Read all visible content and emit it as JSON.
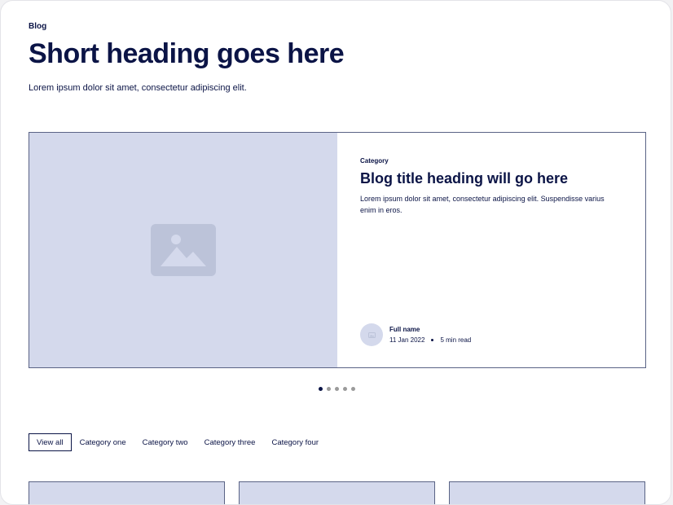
{
  "section": {
    "tagline": "Blog",
    "heading": "Short heading goes here",
    "description": "Lorem ipsum dolor sit amet, consectetur adipiscing elit."
  },
  "featured_post": {
    "image_icon": "image-placeholder-icon",
    "category": "Category",
    "title": "Blog title heading will go here",
    "description": "Lorem ipsum dolor sit amet, consectetur adipiscing elit. Suspendisse varius enim in eros.",
    "author": {
      "avatar_icon": "avatar-placeholder-icon",
      "name": "Full name",
      "date": "11 Jan 2022",
      "read_time": "5 min read"
    }
  },
  "carousel": {
    "slide_count": 5,
    "active_index": 0
  },
  "filter_tabs": [
    {
      "label": "View all",
      "active": true
    },
    {
      "label": "Category one",
      "active": false
    },
    {
      "label": "Category two",
      "active": false
    },
    {
      "label": "Category three",
      "active": false
    },
    {
      "label": "Category four",
      "active": false
    }
  ],
  "colors": {
    "text": "#0b1446",
    "placeholder": "#d4d9ec",
    "placeholder_icon": "#bcc3d9",
    "border": "#5a6385",
    "dot_inactive": "#9a9a9a"
  }
}
